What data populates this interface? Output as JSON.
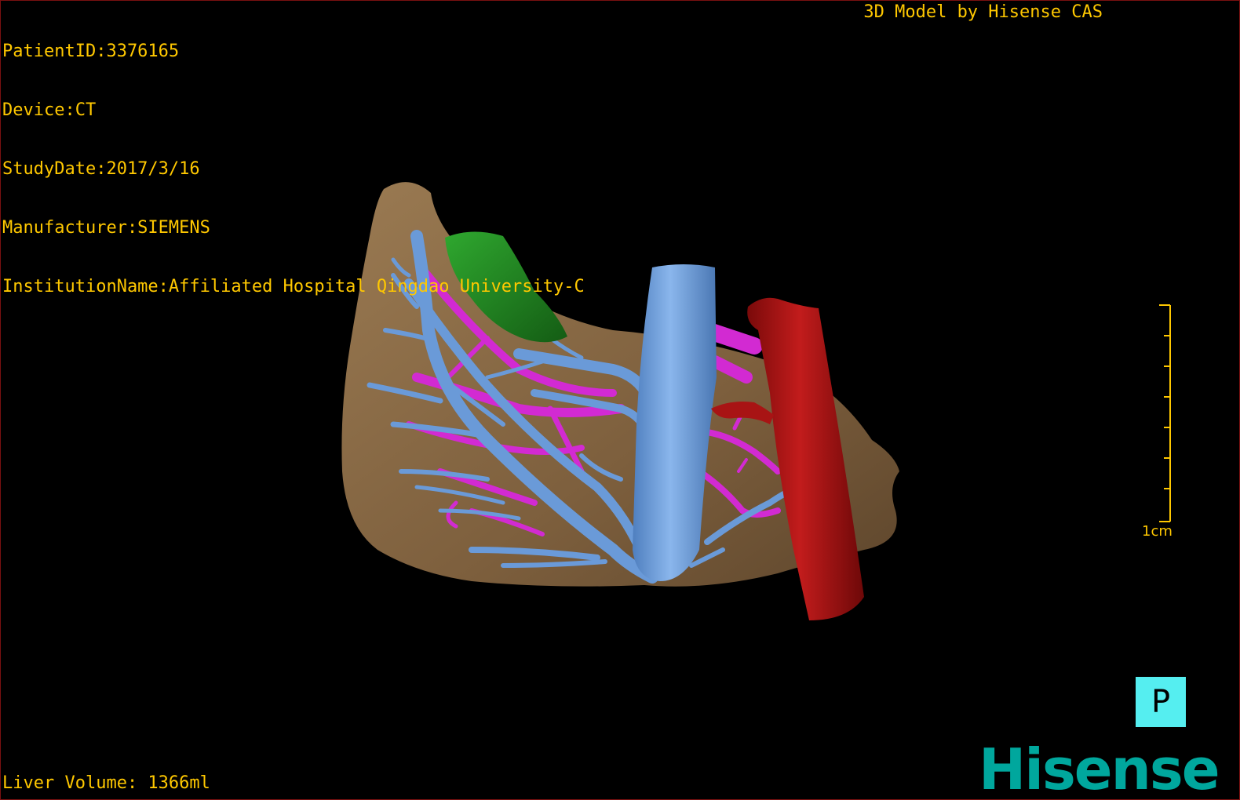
{
  "info": {
    "patient_id": "PatientID:3376165",
    "device": "Device:CT",
    "study_date": "StudyDate:2017/3/16",
    "manufacturer": "Manufacturer:SIEMENS",
    "institution": "InstitutionName:Affiliated Hospital Qingdao University-C"
  },
  "header": {
    "model_credit": "3D Model by Hisense CAS"
  },
  "footer": {
    "liver_volume": "Liver Volume: 1366ml"
  },
  "scale": {
    "label": "1cm"
  },
  "orientation": {
    "label": "P"
  },
  "brand": {
    "logo_text": "Hisense"
  },
  "colors": {
    "overlay_text": "#ffc800",
    "liver": "#8a6a45",
    "hepatic_vein": "#6a9ad8",
    "portal_vein": "#d22ad2",
    "aorta": "#a81414",
    "gallbladder": "#1f8a1f",
    "orientation_button": "#55eef0",
    "brand": "#00a79d"
  },
  "icons": {
    "scale_bar": "scale-ruler-icon",
    "orientation": "orientation-cube-icon"
  }
}
